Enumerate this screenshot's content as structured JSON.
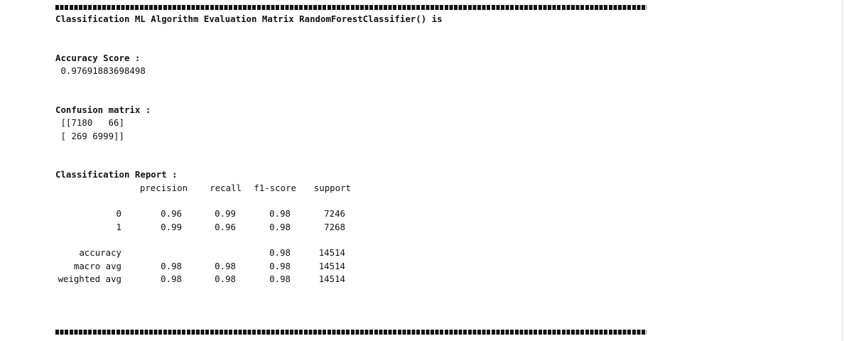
{
  "output": {
    "header_title": "Classification ML Algorithm Evaluation Matrix RandomForestClassifier() is",
    "accuracy_label": "Accuracy Score :",
    "accuracy_value": " 0.97691883698498",
    "confusion_label": "Confusion matrix :",
    "confusion_row1": " [[7180   66]",
    "confusion_row2": " [ 269 6999]]",
    "report_label": "Classification Report :",
    "report_headers": [
      "precision",
      "recall",
      "f1-score",
      "support"
    ],
    "report_rows": [
      {
        "label": "0",
        "precision": "0.96",
        "recall": "0.99",
        "f1": "0.98",
        "support": "7246"
      },
      {
        "label": "1",
        "precision": "0.99",
        "recall": "0.96",
        "f1": "0.98",
        "support": "7268"
      },
      {
        "label": "accuracy",
        "precision": "",
        "recall": "",
        "f1": "0.98",
        "support": "14514"
      },
      {
        "label": "macro avg",
        "precision": "0.98",
        "recall": "0.98",
        "f1": "0.98",
        "support": "14514"
      },
      {
        "label": "weighted avg",
        "precision": "0.98",
        "recall": "0.98",
        "f1": "0.98",
        "support": "14514"
      }
    ]
  }
}
